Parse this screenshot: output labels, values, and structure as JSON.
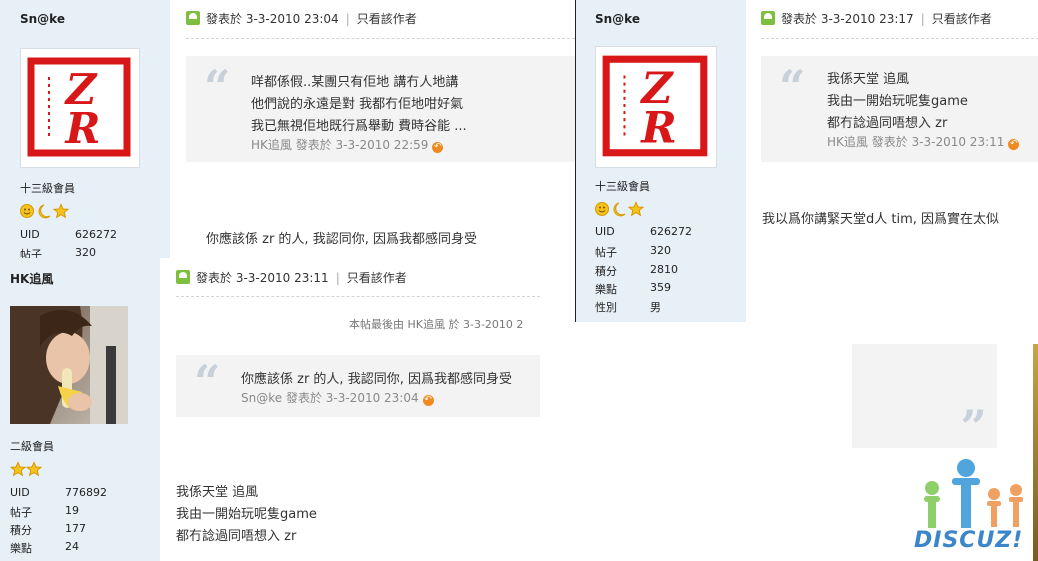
{
  "colors": {
    "sidebar_bg": "#e8f0f7",
    "quote_bg": "#f3f3f3",
    "accent_orange": "#f08a20",
    "icon_green": "#7fbf3f"
  },
  "posts": [
    {
      "user": "Sn@ke",
      "rank": "十三級會員",
      "stars_icons": [
        "smile-icon",
        "moon-icon",
        "star-icon"
      ],
      "stats": [
        {
          "k": "UID",
          "v": "626272"
        },
        {
          "k": "帖子",
          "v": "320"
        }
      ],
      "header": {
        "posted": "發表於 3-3-2010 23:04",
        "only_author": "只看該作者"
      },
      "quote": {
        "lines": [
          "咩都係假..某團只有佢地 講冇人地講",
          "他們說的永遠是對 我都冇佢地咁好氣",
          "我已無視佢地既行爲舉動 費時谷能 ..."
        ],
        "source": "HK追風 發表於 3-3-2010 22:59"
      },
      "body": [
        "你應該係 zr 的人, 我認同你, 因爲我都感同身受"
      ]
    },
    {
      "user": "HK追風",
      "rank": "二級會員",
      "stars_icons": [
        "star-icon",
        "star-icon"
      ],
      "stats": [
        {
          "k": "UID",
          "v": "776892"
        },
        {
          "k": "帖子",
          "v": "19"
        },
        {
          "k": "積分",
          "v": "177"
        },
        {
          "k": "樂點",
          "v": "24"
        }
      ],
      "header": {
        "posted": "發表於 3-3-2010 23:11",
        "only_author": "只看該作者"
      },
      "last_edit": "本帖最後由 HK追風 於 3-3-2010 2",
      "quote": {
        "lines": [
          "你應該係 zr 的人, 我認同你, 因爲我都感同身受"
        ],
        "source": "Sn@ke 發表於 3-3-2010 23:04"
      },
      "body": [
        "我係天堂 追風",
        "我由一開始玩呢隻game",
        "都冇諗過同唔想入 zr"
      ]
    },
    {
      "user": "Sn@ke",
      "rank": "十三級會員",
      "stars_icons": [
        "smile-icon",
        "moon-icon",
        "star-icon"
      ],
      "stats": [
        {
          "k": "UID",
          "v": "626272"
        },
        {
          "k": "帖子",
          "v": "320"
        },
        {
          "k": "積分",
          "v": "2810"
        },
        {
          "k": "樂點",
          "v": "359"
        },
        {
          "k": "性別",
          "v": "男"
        }
      ],
      "header": {
        "posted": "發表於 3-3-2010 23:17",
        "only_author": "只看該作者"
      },
      "quote": {
        "lines": [
          "我係天堂 追風",
          "我由一開始玩呢隻game",
          "都冇諗過同唔想入 zr"
        ],
        "source": "HK追風 發表於 3-3-2010 23:11"
      },
      "body": [
        "我以爲你講緊天堂d人 tim, 因爲實在太似"
      ]
    }
  ],
  "logo": {
    "text": "DISCUZ!"
  }
}
